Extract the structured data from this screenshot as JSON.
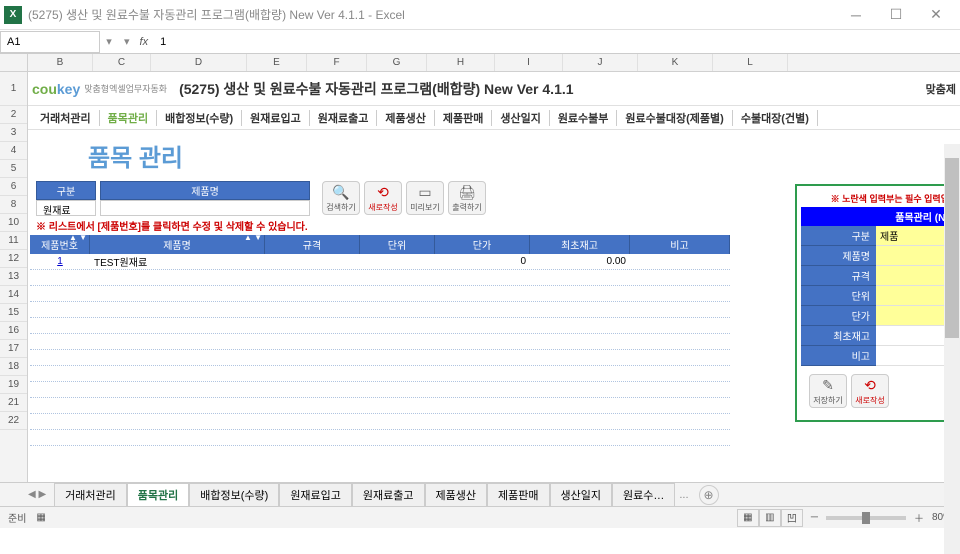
{
  "window": {
    "title": "(5275) 생산 및 원료수불 자동관리 프로그램(배합량) New Ver 4.1.1 - Excel",
    "excel_icon": "X"
  },
  "formula": {
    "cell_ref": "A1",
    "fx": "fx",
    "value": "1"
  },
  "columns": [
    "B",
    "C",
    "D",
    "E",
    "F",
    "G",
    "H",
    "I",
    "J",
    "K",
    "L"
  ],
  "rows": [
    "1",
    "2",
    "3",
    "4",
    "5",
    "6",
    "8",
    "10",
    "11",
    "12",
    "13",
    "14",
    "15",
    "16",
    "17",
    "18",
    "19",
    "21",
    "22"
  ],
  "brand": {
    "logo_cou": "cou",
    "logo_key": "key",
    "sub": "맞춤형엑셀업무자동화",
    "title": "(5275) 생산 및 원료수불 자동관리 프로그램(배합량) New Ver 4.1.1",
    "right": "맞춤제"
  },
  "nav": [
    "거래처관리",
    "품목관리",
    "배합정보(수량)",
    "원재료입고",
    "원재료출고",
    "제품생산",
    "제품판매",
    "생산일지",
    "원료수불부",
    "원료수불대장(제품별)",
    "수불대장(건별)"
  ],
  "nav_active_idx": 1,
  "page_title": "품목 관리",
  "filters": {
    "labels": [
      "구분",
      "제품명"
    ],
    "values": [
      "원재료",
      ""
    ]
  },
  "actions": {
    "search": "검색하기",
    "new": "새로작성",
    "preview": "미리보기",
    "print": "출력하기"
  },
  "warn": "※ 리스트에서 [제품번호]를 클릭하면 수정 및 삭제할 수 있습니다.",
  "table": {
    "headers": [
      "제품번호",
      "제품명",
      "규격",
      "단위",
      "단가",
      "최초재고",
      "비고"
    ],
    "rows": [
      {
        "no": "1",
        "name": "TEST원재료",
        "spec": "",
        "unit": "",
        "price": "0",
        "stock": "0.00",
        "note": ""
      }
    ]
  },
  "side": {
    "warn": "※ 노란색 입력부는 필수 입력입!",
    "title": "품목관리 (NE",
    "fields": [
      "구분",
      "제품명",
      "규격",
      "단위",
      "단가",
      "최초재고",
      "비고"
    ],
    "values": [
      "제품",
      "",
      "",
      "",
      "",
      "",
      ""
    ],
    "save": "저장하기",
    "new": "새로작성"
  },
  "tabs": [
    "거래처관리",
    "품목관리",
    "배합정보(수량)",
    "원재료입고",
    "원재료출고",
    "제품생산",
    "제품판매",
    "생산일지",
    "원료수…"
  ],
  "tabs_active_idx": 1,
  "tabs_more": "...",
  "status": {
    "ready": "준비",
    "zoom": "80%"
  }
}
